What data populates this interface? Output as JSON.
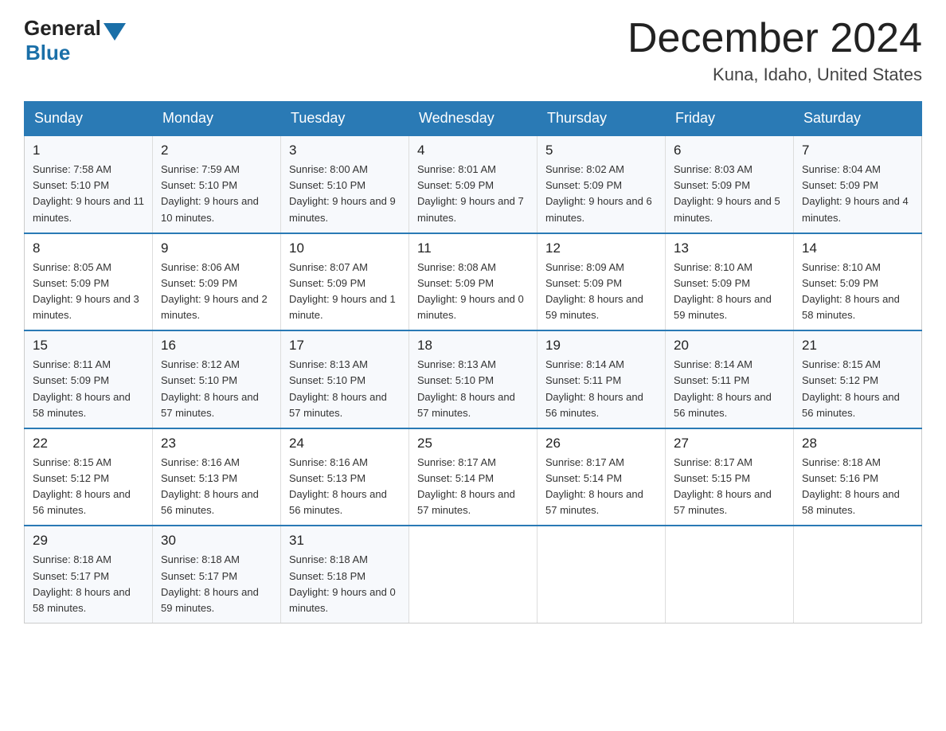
{
  "header": {
    "logo_general": "General",
    "logo_blue": "Blue",
    "title": "December 2024",
    "subtitle": "Kuna, Idaho, United States"
  },
  "days_of_week": [
    "Sunday",
    "Monday",
    "Tuesday",
    "Wednesday",
    "Thursday",
    "Friday",
    "Saturday"
  ],
  "weeks": [
    [
      {
        "num": "1",
        "sunrise": "7:58 AM",
        "sunset": "5:10 PM",
        "daylight": "9 hours and 11 minutes."
      },
      {
        "num": "2",
        "sunrise": "7:59 AM",
        "sunset": "5:10 PM",
        "daylight": "9 hours and 10 minutes."
      },
      {
        "num": "3",
        "sunrise": "8:00 AM",
        "sunset": "5:10 PM",
        "daylight": "9 hours and 9 minutes."
      },
      {
        "num": "4",
        "sunrise": "8:01 AM",
        "sunset": "5:09 PM",
        "daylight": "9 hours and 7 minutes."
      },
      {
        "num": "5",
        "sunrise": "8:02 AM",
        "sunset": "5:09 PM",
        "daylight": "9 hours and 6 minutes."
      },
      {
        "num": "6",
        "sunrise": "8:03 AM",
        "sunset": "5:09 PM",
        "daylight": "9 hours and 5 minutes."
      },
      {
        "num": "7",
        "sunrise": "8:04 AM",
        "sunset": "5:09 PM",
        "daylight": "9 hours and 4 minutes."
      }
    ],
    [
      {
        "num": "8",
        "sunrise": "8:05 AM",
        "sunset": "5:09 PM",
        "daylight": "9 hours and 3 minutes."
      },
      {
        "num": "9",
        "sunrise": "8:06 AM",
        "sunset": "5:09 PM",
        "daylight": "9 hours and 2 minutes."
      },
      {
        "num": "10",
        "sunrise": "8:07 AM",
        "sunset": "5:09 PM",
        "daylight": "9 hours and 1 minute."
      },
      {
        "num": "11",
        "sunrise": "8:08 AM",
        "sunset": "5:09 PM",
        "daylight": "9 hours and 0 minutes."
      },
      {
        "num": "12",
        "sunrise": "8:09 AM",
        "sunset": "5:09 PM",
        "daylight": "8 hours and 59 minutes."
      },
      {
        "num": "13",
        "sunrise": "8:10 AM",
        "sunset": "5:09 PM",
        "daylight": "8 hours and 59 minutes."
      },
      {
        "num": "14",
        "sunrise": "8:10 AM",
        "sunset": "5:09 PM",
        "daylight": "8 hours and 58 minutes."
      }
    ],
    [
      {
        "num": "15",
        "sunrise": "8:11 AM",
        "sunset": "5:09 PM",
        "daylight": "8 hours and 58 minutes."
      },
      {
        "num": "16",
        "sunrise": "8:12 AM",
        "sunset": "5:10 PM",
        "daylight": "8 hours and 57 minutes."
      },
      {
        "num": "17",
        "sunrise": "8:13 AM",
        "sunset": "5:10 PM",
        "daylight": "8 hours and 57 minutes."
      },
      {
        "num": "18",
        "sunrise": "8:13 AM",
        "sunset": "5:10 PM",
        "daylight": "8 hours and 57 minutes."
      },
      {
        "num": "19",
        "sunrise": "8:14 AM",
        "sunset": "5:11 PM",
        "daylight": "8 hours and 56 minutes."
      },
      {
        "num": "20",
        "sunrise": "8:14 AM",
        "sunset": "5:11 PM",
        "daylight": "8 hours and 56 minutes."
      },
      {
        "num": "21",
        "sunrise": "8:15 AM",
        "sunset": "5:12 PM",
        "daylight": "8 hours and 56 minutes."
      }
    ],
    [
      {
        "num": "22",
        "sunrise": "8:15 AM",
        "sunset": "5:12 PM",
        "daylight": "8 hours and 56 minutes."
      },
      {
        "num": "23",
        "sunrise": "8:16 AM",
        "sunset": "5:13 PM",
        "daylight": "8 hours and 56 minutes."
      },
      {
        "num": "24",
        "sunrise": "8:16 AM",
        "sunset": "5:13 PM",
        "daylight": "8 hours and 56 minutes."
      },
      {
        "num": "25",
        "sunrise": "8:17 AM",
        "sunset": "5:14 PM",
        "daylight": "8 hours and 57 minutes."
      },
      {
        "num": "26",
        "sunrise": "8:17 AM",
        "sunset": "5:14 PM",
        "daylight": "8 hours and 57 minutes."
      },
      {
        "num": "27",
        "sunrise": "8:17 AM",
        "sunset": "5:15 PM",
        "daylight": "8 hours and 57 minutes."
      },
      {
        "num": "28",
        "sunrise": "8:18 AM",
        "sunset": "5:16 PM",
        "daylight": "8 hours and 58 minutes."
      }
    ],
    [
      {
        "num": "29",
        "sunrise": "8:18 AM",
        "sunset": "5:17 PM",
        "daylight": "8 hours and 58 minutes."
      },
      {
        "num": "30",
        "sunrise": "8:18 AM",
        "sunset": "5:17 PM",
        "daylight": "8 hours and 59 minutes."
      },
      {
        "num": "31",
        "sunrise": "8:18 AM",
        "sunset": "5:18 PM",
        "daylight": "9 hours and 0 minutes."
      },
      null,
      null,
      null,
      null
    ]
  ],
  "labels": {
    "sunrise_prefix": "Sunrise: ",
    "sunset_prefix": "Sunset: ",
    "daylight_prefix": "Daylight: "
  }
}
